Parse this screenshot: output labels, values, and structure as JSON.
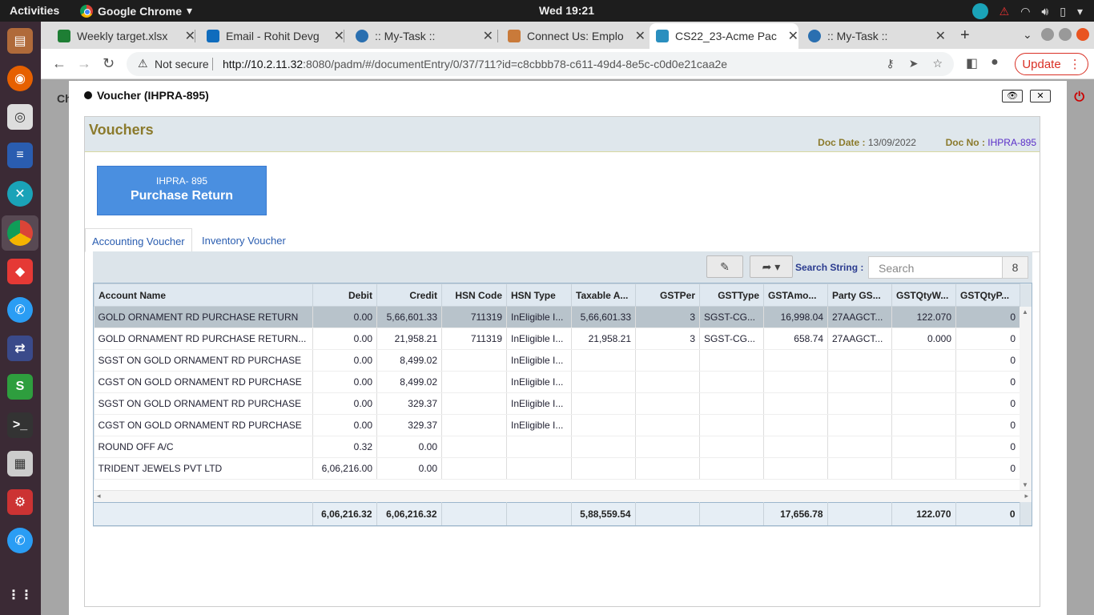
{
  "system": {
    "activities": "Activities",
    "app_name": "Google Chrome",
    "clock": "Wed 19:21"
  },
  "tabs": [
    {
      "title": "Weekly target.xlsx",
      "icon_color": "#1e7e34"
    },
    {
      "title": "Email - Rohit Devg",
      "icon_color": "#0f6cbd"
    },
    {
      "title": ":: My-Task ::",
      "icon_color": "#2a6fb0"
    },
    {
      "title": "Connect Us: Emplo",
      "icon_color": "#c97a3a"
    },
    {
      "title": "CS22_23-Acme Pac",
      "icon_color": "#2a8fbf"
    },
    {
      "title": ":: My-Task ::",
      "icon_color": "#2a6fb0"
    }
  ],
  "address_bar": {
    "security": "Not secure",
    "url_host": "http://10.2.11.32",
    "url_rest": ":8080/padm/#/documentEntry/0/37/711?id=c8cbbb78-c611-49d4-8e5c-c0d0e21caa2e"
  },
  "update_label": "Update",
  "background_letters": "Ch",
  "modal": {
    "title": "Voucher (IHPRA-895)",
    "heading": "Vouchers",
    "doc_date_label": "Doc Date :",
    "doc_date": "13/09/2022",
    "doc_no_label": "Doc No :",
    "doc_no": "IHPRA-895",
    "voucher_code": "IHPRA- 895",
    "voucher_type": "Purchase Return",
    "tab_accounting": "Accounting Voucher",
    "tab_inventory": "Inventory Voucher",
    "search_label": "Search String :",
    "search_placeholder": "Search",
    "search_count": "8"
  },
  "columns": [
    "Account Name",
    "Debit",
    "Credit",
    "HSN Code",
    "HSN Type",
    "Taxable A...",
    "GSTPer",
    "GSTType",
    "GSTAmo...",
    "Party GS...",
    "GSTQtyW...",
    "GSTQtyP..."
  ],
  "rows": [
    {
      "account": "GOLD ORNAMENT RD PURCHASE RETURN",
      "debit": "0.00",
      "credit": "5,66,601.33",
      "hsn_code": "711319",
      "hsn_type": "InEligible I...",
      "taxable": "5,66,601.33",
      "gst_per": "3",
      "gst_type": "SGST-CG...",
      "gst_amt": "16,998.04",
      "party_gs": "27AAGCT...",
      "qty_w": "122.070",
      "qty_p": "0"
    },
    {
      "account": "GOLD ORNAMENT RD PURCHASE RETURN...",
      "debit": "0.00",
      "credit": "21,958.21",
      "hsn_code": "711319",
      "hsn_type": "InEligible I...",
      "taxable": "21,958.21",
      "gst_per": "3",
      "gst_type": "SGST-CG...",
      "gst_amt": "658.74",
      "party_gs": "27AAGCT...",
      "qty_w": "0.000",
      "qty_p": "0"
    },
    {
      "account": "SGST ON GOLD ORNAMENT RD PURCHASE",
      "debit": "0.00",
      "credit": "8,499.02",
      "hsn_code": "",
      "hsn_type": "InEligible I...",
      "taxable": "",
      "gst_per": "",
      "gst_type": "",
      "gst_amt": "",
      "party_gs": "",
      "qty_w": "",
      "qty_p": "0"
    },
    {
      "account": "CGST ON GOLD ORNAMENT RD PURCHASE",
      "debit": "0.00",
      "credit": "8,499.02",
      "hsn_code": "",
      "hsn_type": "InEligible I...",
      "taxable": "",
      "gst_per": "",
      "gst_type": "",
      "gst_amt": "",
      "party_gs": "",
      "qty_w": "",
      "qty_p": "0"
    },
    {
      "account": "SGST ON GOLD ORNAMENT RD PURCHASE",
      "debit": "0.00",
      "credit": "329.37",
      "hsn_code": "",
      "hsn_type": "InEligible I...",
      "taxable": "",
      "gst_per": "",
      "gst_type": "",
      "gst_amt": "",
      "party_gs": "",
      "qty_w": "",
      "qty_p": "0"
    },
    {
      "account": "CGST ON GOLD ORNAMENT RD PURCHASE",
      "debit": "0.00",
      "credit": "329.37",
      "hsn_code": "",
      "hsn_type": "InEligible I...",
      "taxable": "",
      "gst_per": "",
      "gst_type": "",
      "gst_amt": "",
      "party_gs": "",
      "qty_w": "",
      "qty_p": "0"
    },
    {
      "account": "ROUND OFF A/C",
      "debit": "0.32",
      "credit": "0.00",
      "hsn_code": "",
      "hsn_type": "",
      "taxable": "",
      "gst_per": "",
      "gst_type": "",
      "gst_amt": "",
      "party_gs": "",
      "qty_w": "",
      "qty_p": "0"
    },
    {
      "account": "TRIDENT JEWELS PVT LTD",
      "debit": "6,06,216.00",
      "credit": "0.00",
      "hsn_code": "",
      "hsn_type": "",
      "taxable": "",
      "gst_per": "",
      "gst_type": "",
      "gst_amt": "",
      "party_gs": "",
      "qty_w": "",
      "qty_p": "0"
    }
  ],
  "totals": {
    "account": "",
    "debit": "6,06,216.32",
    "credit": "6,06,216.32",
    "hsn_code": "",
    "hsn_type": "",
    "taxable": "5,88,559.54",
    "gst_per": "",
    "gst_type": "",
    "gst_amt": "17,656.78",
    "party_gs": "",
    "qty_w": "122.070",
    "qty_p": "0"
  },
  "colors": {
    "accent_blue": "#4a8fe0",
    "heading_olive": "#8b7a2c",
    "doc_no_purple": "#5a2ec8",
    "update_red": "#d93025"
  }
}
